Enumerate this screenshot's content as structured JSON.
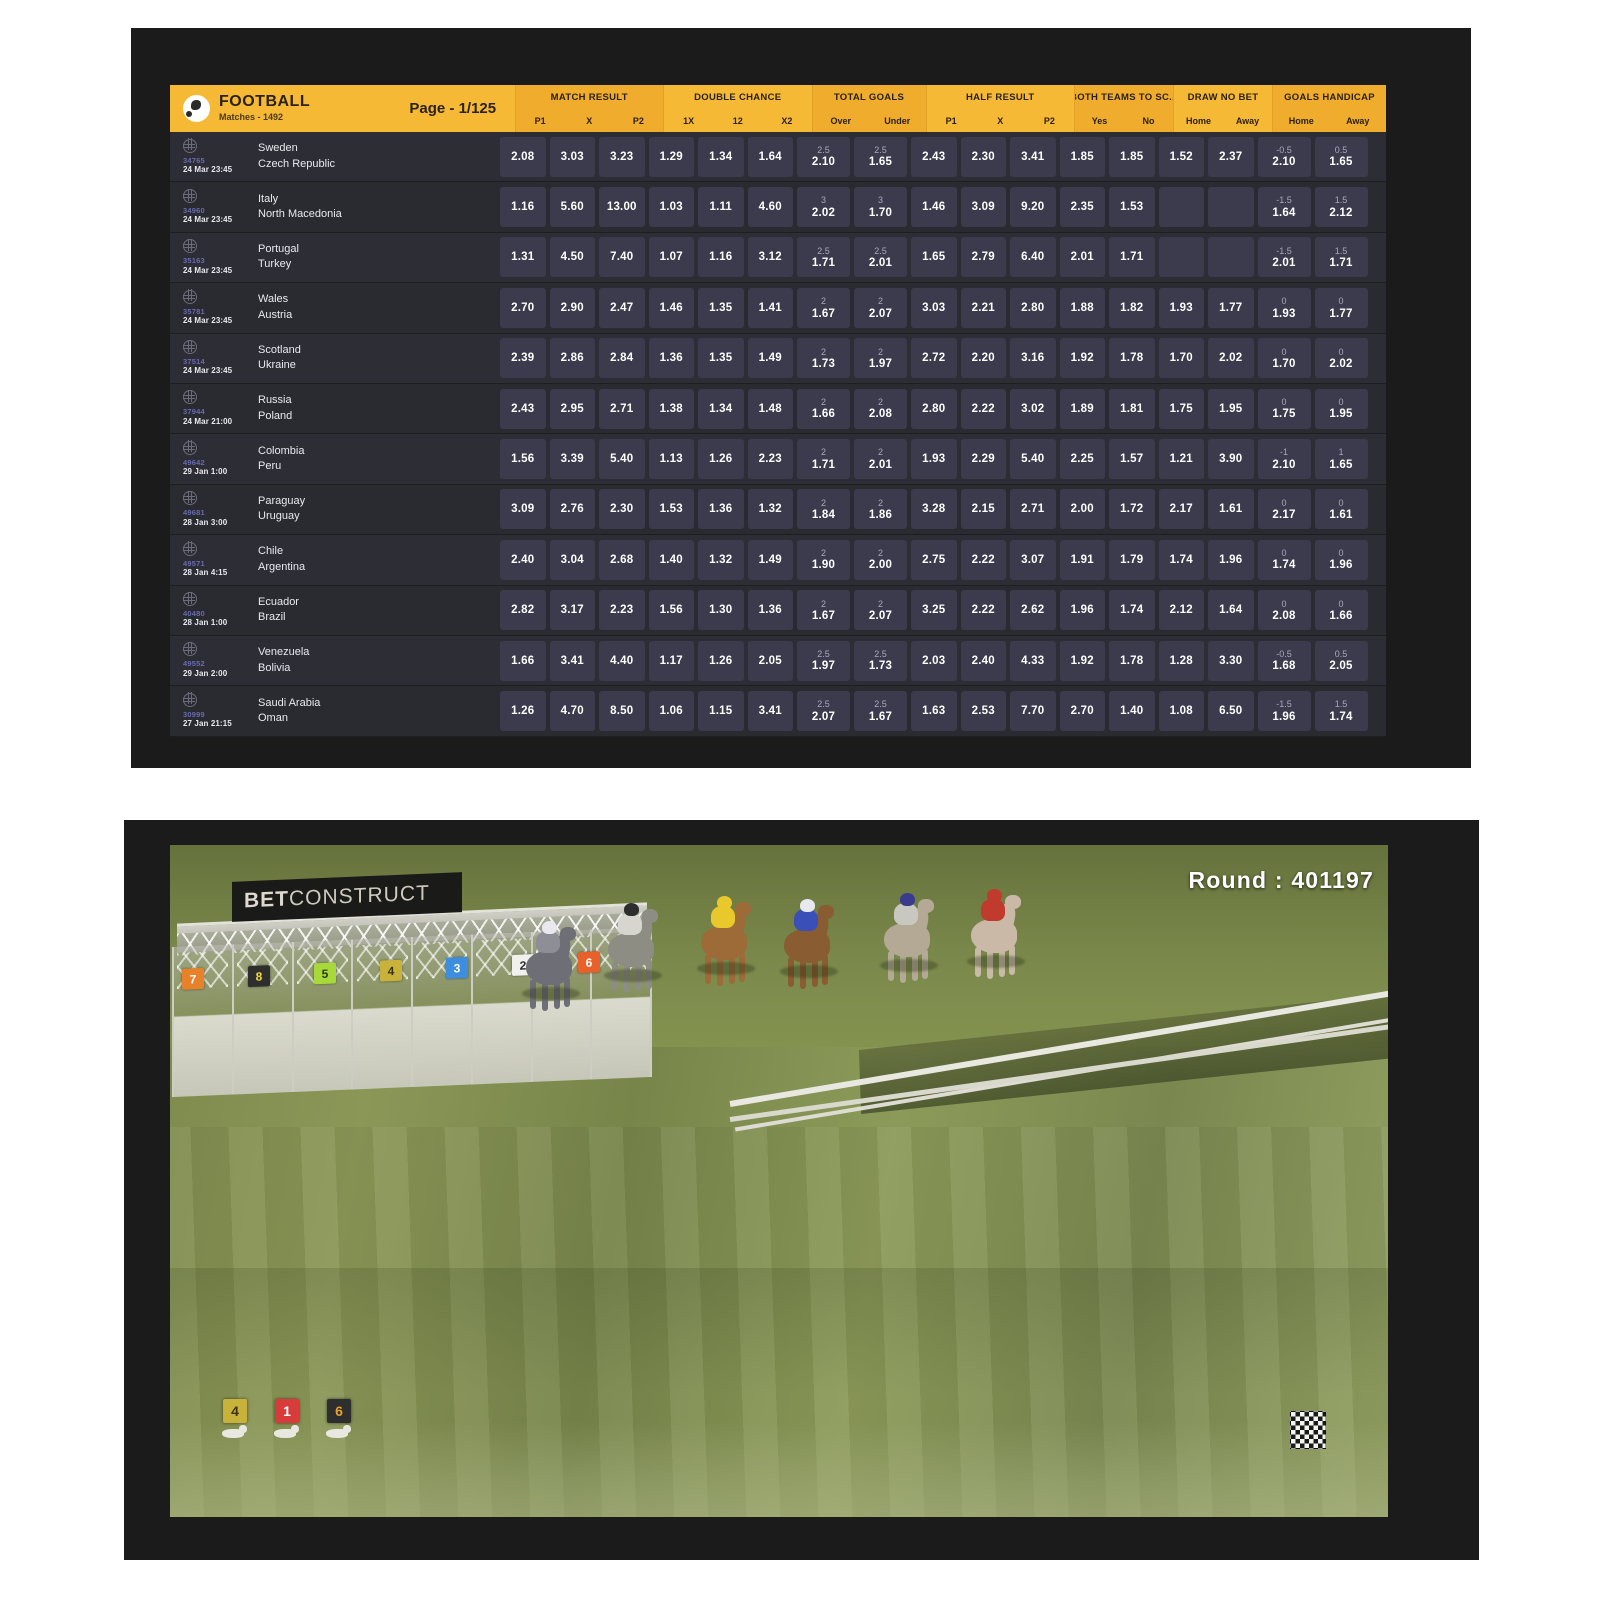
{
  "football_board": {
    "title": "FOOTBALL",
    "subtitle": "Matches - 1492",
    "page_label": "Page - 1/125",
    "ball_icon": "football-icon",
    "accent_color": "#f5b936",
    "row_bg_color": "#2d2d35",
    "odd_cell_color": "#3b3b4d",
    "markets": [
      {
        "name": "MATCH RESULT",
        "columns": [
          "P1",
          "X",
          "P2"
        ]
      },
      {
        "name": "DOUBLE CHANCE",
        "columns": [
          "1X",
          "12",
          "X2"
        ]
      },
      {
        "name": "TOTAL GOALS",
        "columns": [
          "Over",
          "Under"
        ]
      },
      {
        "name": "HALF RESULT",
        "columns": [
          "P1",
          "X",
          "P2"
        ]
      },
      {
        "name": "BOTH TEAMS TO SC...",
        "columns": [
          "Yes",
          "No"
        ]
      },
      {
        "name": "DRAW NO BET",
        "columns": [
          "Home",
          "Away"
        ]
      },
      {
        "name": "GOALS HANDICAP",
        "columns": [
          "Home",
          "Away"
        ]
      }
    ],
    "matches": [
      {
        "code": "34765",
        "date": "24 Mar 23:45",
        "home": "Sweden",
        "away": "Czech Republic",
        "match_result": [
          "2.08",
          "3.03",
          "3.23"
        ],
        "double_chance": [
          "1.29",
          "1.34",
          "1.64"
        ],
        "total_goals": [
          {
            "line": "2.5",
            "odd": "2.10"
          },
          {
            "line": "2.5",
            "odd": "1.65"
          }
        ],
        "half_result": [
          "2.43",
          "2.30",
          "3.41"
        ],
        "btts": [
          "1.85",
          "1.85"
        ],
        "draw_no_bet": [
          "1.52",
          "2.37"
        ],
        "handicap": [
          {
            "line": "-0.5",
            "odd": "2.10"
          },
          {
            "line": "0.5",
            "odd": "1.65"
          }
        ]
      },
      {
        "code": "34960",
        "date": "24 Mar 23:45",
        "home": "Italy",
        "away": "North Macedonia",
        "match_result": [
          "1.16",
          "5.60",
          "13.00"
        ],
        "double_chance": [
          "1.03",
          "1.11",
          "4.60"
        ],
        "total_goals": [
          {
            "line": "3",
            "odd": "2.02"
          },
          {
            "line": "3",
            "odd": "1.70"
          }
        ],
        "half_result": [
          "1.46",
          "3.09",
          "9.20"
        ],
        "btts": [
          "2.35",
          "1.53"
        ],
        "draw_no_bet": [
          "",
          ""
        ],
        "handicap": [
          {
            "line": "-1.5",
            "odd": "1.64"
          },
          {
            "line": "1.5",
            "odd": "2.12"
          }
        ]
      },
      {
        "code": "35163",
        "date": "24 Mar 23:45",
        "home": "Portugal",
        "away": "Turkey",
        "match_result": [
          "1.31",
          "4.50",
          "7.40"
        ],
        "double_chance": [
          "1.07",
          "1.16",
          "3.12"
        ],
        "total_goals": [
          {
            "line": "2.5",
            "odd": "1.71"
          },
          {
            "line": "2.5",
            "odd": "2.01"
          }
        ],
        "half_result": [
          "1.65",
          "2.79",
          "6.40"
        ],
        "btts": [
          "2.01",
          "1.71"
        ],
        "draw_no_bet": [
          "",
          ""
        ],
        "handicap": [
          {
            "line": "-1.5",
            "odd": "2.01"
          },
          {
            "line": "1.5",
            "odd": "1.71"
          }
        ]
      },
      {
        "code": "35781",
        "date": "24 Mar 23:45",
        "home": "Wales",
        "away": "Austria",
        "match_result": [
          "2.70",
          "2.90",
          "2.47"
        ],
        "double_chance": [
          "1.46",
          "1.35",
          "1.41"
        ],
        "total_goals": [
          {
            "line": "2",
            "odd": "1.67"
          },
          {
            "line": "2",
            "odd": "2.07"
          }
        ],
        "half_result": [
          "3.03",
          "2.21",
          "2.80"
        ],
        "btts": [
          "1.88",
          "1.82"
        ],
        "draw_no_bet": [
          "1.93",
          "1.77"
        ],
        "handicap": [
          {
            "line": "0",
            "odd": "1.93"
          },
          {
            "line": "0",
            "odd": "1.77"
          }
        ]
      },
      {
        "code": "37514",
        "date": "24 Mar 23:45",
        "home": "Scotland",
        "away": "Ukraine",
        "match_result": [
          "2.39",
          "2.86",
          "2.84"
        ],
        "double_chance": [
          "1.36",
          "1.35",
          "1.49"
        ],
        "total_goals": [
          {
            "line": "2",
            "odd": "1.73"
          },
          {
            "line": "2",
            "odd": "1.97"
          }
        ],
        "half_result": [
          "2.72",
          "2.20",
          "3.16"
        ],
        "btts": [
          "1.92",
          "1.78"
        ],
        "draw_no_bet": [
          "1.70",
          "2.02"
        ],
        "handicap": [
          {
            "line": "0",
            "odd": "1.70"
          },
          {
            "line": "0",
            "odd": "2.02"
          }
        ]
      },
      {
        "code": "37944",
        "date": "24 Mar 21:00",
        "home": "Russia",
        "away": "Poland",
        "match_result": [
          "2.43",
          "2.95",
          "2.71"
        ],
        "double_chance": [
          "1.38",
          "1.34",
          "1.48"
        ],
        "total_goals": [
          {
            "line": "2",
            "odd": "1.66"
          },
          {
            "line": "2",
            "odd": "2.08"
          }
        ],
        "half_result": [
          "2.80",
          "2.22",
          "3.02"
        ],
        "btts": [
          "1.89",
          "1.81"
        ],
        "draw_no_bet": [
          "1.75",
          "1.95"
        ],
        "handicap": [
          {
            "line": "0",
            "odd": "1.75"
          },
          {
            "line": "0",
            "odd": "1.95"
          }
        ]
      },
      {
        "code": "49642",
        "date": "29 Jan 1:00",
        "home": "Colombia",
        "away": "Peru",
        "match_result": [
          "1.56",
          "3.39",
          "5.40"
        ],
        "double_chance": [
          "1.13",
          "1.26",
          "2.23"
        ],
        "total_goals": [
          {
            "line": "2",
            "odd": "1.71"
          },
          {
            "line": "2",
            "odd": "2.01"
          }
        ],
        "half_result": [
          "1.93",
          "2.29",
          "5.40"
        ],
        "btts": [
          "2.25",
          "1.57"
        ],
        "draw_no_bet": [
          "1.21",
          "3.90"
        ],
        "handicap": [
          {
            "line": "-1",
            "odd": "2.10"
          },
          {
            "line": "1",
            "odd": "1.65"
          }
        ]
      },
      {
        "code": "49681",
        "date": "28 Jan 3:00",
        "home": "Paraguay",
        "away": "Uruguay",
        "match_result": [
          "3.09",
          "2.76",
          "2.30"
        ],
        "double_chance": [
          "1.53",
          "1.36",
          "1.32"
        ],
        "total_goals": [
          {
            "line": "2",
            "odd": "1.84"
          },
          {
            "line": "2",
            "odd": "1.86"
          }
        ],
        "half_result": [
          "3.28",
          "2.15",
          "2.71"
        ],
        "btts": [
          "2.00",
          "1.72"
        ],
        "draw_no_bet": [
          "2.17",
          "1.61"
        ],
        "handicap": [
          {
            "line": "0",
            "odd": "2.17"
          },
          {
            "line": "0",
            "odd": "1.61"
          }
        ]
      },
      {
        "code": "49571",
        "date": "28 Jan 4:15",
        "home": "Chile",
        "away": "Argentina",
        "match_result": [
          "2.40",
          "3.04",
          "2.68"
        ],
        "double_chance": [
          "1.40",
          "1.32",
          "1.49"
        ],
        "total_goals": [
          {
            "line": "2",
            "odd": "1.90"
          },
          {
            "line": "2",
            "odd": "2.00"
          }
        ],
        "half_result": [
          "2.75",
          "2.22",
          "3.07"
        ],
        "btts": [
          "1.91",
          "1.79"
        ],
        "draw_no_bet": [
          "1.74",
          "1.96"
        ],
        "handicap": [
          {
            "line": "0",
            "odd": "1.74"
          },
          {
            "line": "0",
            "odd": "1.96"
          }
        ]
      },
      {
        "code": "40480",
        "date": "28 Jan 1:00",
        "home": "Ecuador",
        "away": "Brazil",
        "match_result": [
          "2.82",
          "3.17",
          "2.23"
        ],
        "double_chance": [
          "1.56",
          "1.30",
          "1.36"
        ],
        "total_goals": [
          {
            "line": "2",
            "odd": "1.67"
          },
          {
            "line": "2",
            "odd": "2.07"
          }
        ],
        "half_result": [
          "3.25",
          "2.22",
          "2.62"
        ],
        "btts": [
          "1.96",
          "1.74"
        ],
        "draw_no_bet": [
          "2.12",
          "1.64"
        ],
        "handicap": [
          {
            "line": "0",
            "odd": "2.08"
          },
          {
            "line": "0",
            "odd": "1.66"
          }
        ]
      },
      {
        "code": "49552",
        "date": "29 Jan 2:00",
        "home": "Venezuela",
        "away": "Bolivia",
        "match_result": [
          "1.66",
          "3.41",
          "4.40"
        ],
        "double_chance": [
          "1.17",
          "1.26",
          "2.05"
        ],
        "total_goals": [
          {
            "line": "2.5",
            "odd": "1.97"
          },
          {
            "line": "2.5",
            "odd": "1.73"
          }
        ],
        "half_result": [
          "2.03",
          "2.40",
          "4.33"
        ],
        "btts": [
          "1.92",
          "1.78"
        ],
        "draw_no_bet": [
          "1.28",
          "3.30"
        ],
        "handicap": [
          {
            "line": "-0.5",
            "odd": "1.68"
          },
          {
            "line": "0.5",
            "odd": "2.05"
          }
        ]
      },
      {
        "code": "30999",
        "date": "27 Jan 21:15",
        "home": "Saudi Arabia",
        "away": "Oman",
        "match_result": [
          "1.26",
          "4.70",
          "8.50"
        ],
        "double_chance": [
          "1.06",
          "1.15",
          "3.41"
        ],
        "total_goals": [
          {
            "line": "2.5",
            "odd": "2.07"
          },
          {
            "line": "2.5",
            "odd": "1.67"
          }
        ],
        "half_result": [
          "1.63",
          "2.53",
          "7.70"
        ],
        "btts": [
          "2.70",
          "1.40"
        ],
        "draw_no_bet": [
          "1.08",
          "6.50"
        ],
        "handicap": [
          {
            "line": "-1.5",
            "odd": "1.96"
          },
          {
            "line": "1.5",
            "odd": "1.74"
          }
        ]
      }
    ]
  },
  "racing_stream": {
    "round_label": "Round : 401197",
    "banner_text_bold": "BET",
    "banner_text_thin": "CONSTRUCT",
    "gate_badges": [
      {
        "number": "7",
        "bg": "#e8822a",
        "fg": "#ffffff"
      },
      {
        "number": "8",
        "bg": "#2e2e2e",
        "fg": "#f2d83a"
      },
      {
        "number": "5",
        "bg": "#a8d93a",
        "fg": "#2d3a10"
      },
      {
        "number": "4",
        "bg": "#c8b23a",
        "fg": "#3a3110"
      },
      {
        "number": "3",
        "bg": "#3d8ede",
        "fg": "#ffffff"
      },
      {
        "number": "2",
        "bg": "#f0f0ee",
        "fg": "#2b2b2b"
      },
      {
        "number": "6",
        "bg": "#e8602a",
        "fg": "#ffffff"
      }
    ],
    "runner_strip": [
      {
        "number": "4",
        "bg": "#c8b23a",
        "fg": "#3a3110"
      },
      {
        "number": "1",
        "bg": "#d93a3a",
        "fg": "#ffffff"
      },
      {
        "number": "6",
        "bg": "#2e2e2e",
        "fg": "#e8a02a"
      }
    ],
    "horses": [
      {
        "silk": "#8e8e96",
        "helmet": "#e8e8ee",
        "body": "#6e6e76"
      },
      {
        "silk": "#d6d6cf",
        "helmet": "#2e2e2e",
        "body": "#8d8d84"
      },
      {
        "silk": "#e8c82a",
        "helmet": "#e8c82a",
        "body": "#9c6b38"
      },
      {
        "silk": "#3a4fb8",
        "helmet": "#e8e8ee",
        "body": "#8a5c32"
      },
      {
        "silk": "#c8c8c0",
        "helmet": "#3a3a8e",
        "body": "#b3a995"
      },
      {
        "silk": "#c03a2e",
        "helmet": "#c03a2e",
        "body": "#c9b9a6"
      }
    ],
    "finish_flag": "checkered-flag-icon"
  }
}
